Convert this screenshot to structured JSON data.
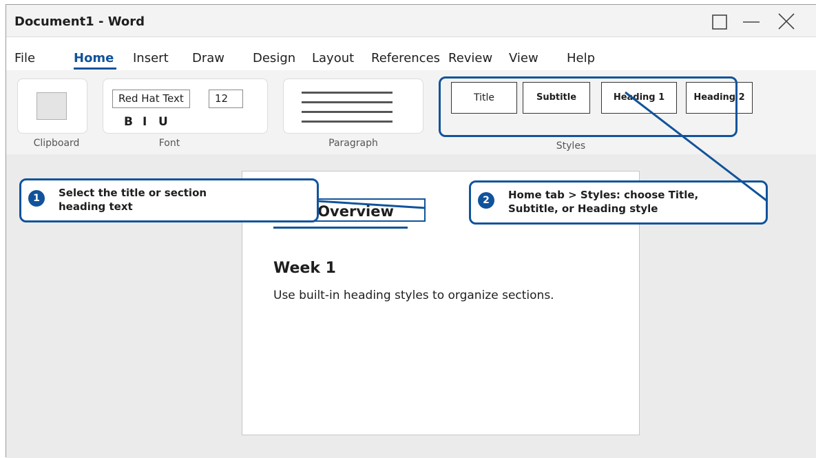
{
  "window": {
    "title": "Document1 - Word",
    "controls": [
      "maximize",
      "minimize",
      "close"
    ]
  },
  "menu": {
    "items": [
      "File",
      "Home",
      "Insert",
      "Draw",
      "Design",
      "Layout",
      "References",
      "Review",
      "View",
      "Help"
    ],
    "active": "Home"
  },
  "ribbon": {
    "clipboard": {
      "label": "Clipboard"
    },
    "font": {
      "label": "Font",
      "name": "Red Hat Text",
      "size": "12",
      "bold": "B",
      "italic": "I",
      "underline": "U"
    },
    "paragraph": {
      "label": "Paragraph"
    },
    "styles": {
      "label": "Styles",
      "items": [
        "Title",
        "Subtitle",
        "Heading 1",
        "Heading 2"
      ]
    }
  },
  "document": {
    "title_text": "Course Overview",
    "heading": "Week 1",
    "body": "Use built-in heading styles to organize sections."
  },
  "callouts": [
    {
      "number": "1",
      "line1": "Select the title or section",
      "line2": "heading text"
    },
    {
      "number": "2",
      "line1": "Home tab > Styles: choose Title,",
      "line2": "Subtitle, or Heading style"
    }
  ],
  "colors": {
    "accent": "#11539b",
    "workspace": "#ebebeb",
    "ribbon": "#f3f3f3"
  }
}
